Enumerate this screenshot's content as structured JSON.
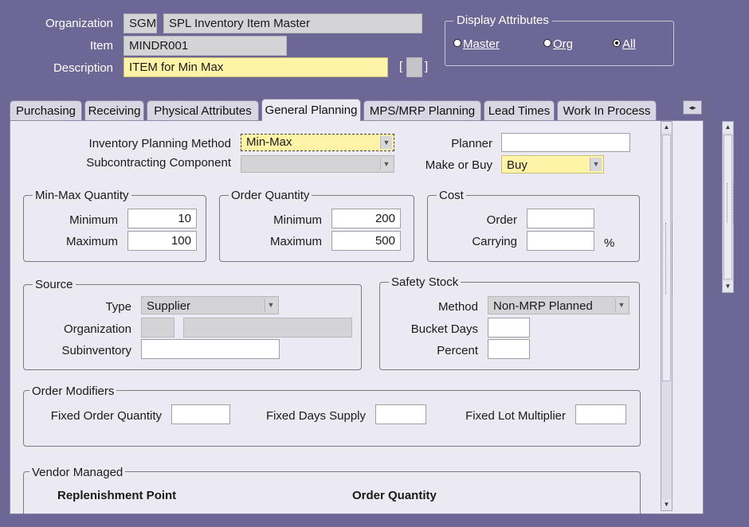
{
  "header": {
    "organization_label": "Organization",
    "organization_code": "SGM",
    "organization_name": "SPL Inventory Item Master",
    "item_label": "Item",
    "item_value": "MINDR001",
    "description_label": "Description",
    "description_value": "ITEM for Min Max",
    "bracket_open": "[",
    "bracket_close": "]"
  },
  "display_attributes": {
    "title": "Display Attributes",
    "options": [
      {
        "label": "Master",
        "selected": false
      },
      {
        "label": "Org",
        "selected": false
      },
      {
        "label": "All",
        "selected": true
      }
    ]
  },
  "tabs": [
    {
      "label": "Purchasing",
      "active": false
    },
    {
      "label": "Receiving",
      "active": false
    },
    {
      "label": "Physical Attributes",
      "active": false
    },
    {
      "label": "General Planning",
      "active": true
    },
    {
      "label": "MPS/MRP Planning",
      "active": false
    },
    {
      "label": "Lead Times",
      "active": false
    },
    {
      "label": "Work In Process",
      "active": false
    }
  ],
  "tab_scroll_icon": "left-right-arrows-icon",
  "planning": {
    "inventory_planning_method_label": "Inventory Planning Method",
    "inventory_planning_method_value": "Min-Max",
    "subcontracting_component_label": "Subcontracting Component",
    "subcontracting_component_value": "",
    "planner_label": "Planner",
    "planner_value": "",
    "make_or_buy_label": "Make or Buy",
    "make_or_buy_value": "Buy"
  },
  "min_max_quantity": {
    "title": "Min-Max Quantity",
    "minimum_label": "Minimum",
    "minimum_value": "10",
    "maximum_label": "Maximum",
    "maximum_value": "100"
  },
  "order_quantity": {
    "title": "Order Quantity",
    "minimum_label": "Minimum",
    "minimum_value": "200",
    "maximum_label": "Maximum",
    "maximum_value": "500"
  },
  "cost": {
    "title": "Cost",
    "order_label": "Order",
    "order_value": "",
    "carrying_label": "Carrying",
    "carrying_value": "",
    "percent_sign": "%"
  },
  "source": {
    "title": "Source",
    "type_label": "Type",
    "type_value": "Supplier",
    "organization_label": "Organization",
    "organization_code": "",
    "organization_name": "",
    "subinventory_label": "Subinventory",
    "subinventory_value": ""
  },
  "safety_stock": {
    "title": "Safety Stock",
    "method_label": "Method",
    "method_value": "Non-MRP Planned",
    "bucket_days_label": "Bucket Days",
    "bucket_days_value": "",
    "percent_label": "Percent",
    "percent_value": ""
  },
  "order_modifiers": {
    "title": "Order Modifiers",
    "fixed_order_quantity_label": "Fixed Order Quantity",
    "fixed_order_quantity_value": "",
    "fixed_days_supply_label": "Fixed Days Supply",
    "fixed_days_supply_value": "",
    "fixed_lot_multiplier_label": "Fixed Lot Multiplier",
    "fixed_lot_multiplier_value": ""
  },
  "vendor_managed": {
    "title": "Vendor Managed",
    "replenishment_point_heading": "Replenishment Point",
    "order_quantity_heading": "Order Quantity"
  }
}
